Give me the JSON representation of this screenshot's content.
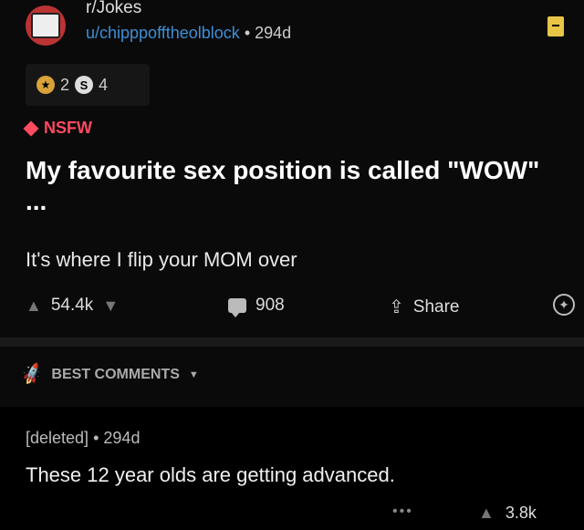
{
  "post": {
    "subreddit": "r/Jokes",
    "user": "u/chipppofftheolblock",
    "separator": "•",
    "age": "294d",
    "awards": [
      {
        "icon": "award-icon",
        "count": "2"
      },
      {
        "icon": "silver-award-icon",
        "glyph": "S",
        "count": "4"
      }
    ],
    "nsfw_label": "NSFW",
    "title": "My favourite sex position is called \"WOW\" ...",
    "body": "It's where I flip your MOM over",
    "upvotes": "54.4k",
    "comments": "908",
    "share_label": "Share"
  },
  "best_comments": {
    "label": "BEST COMMENTS"
  },
  "comment": {
    "author": "[deleted]",
    "separator": "•",
    "age": "294d",
    "text": "These 12 year olds are getting advanced.",
    "more": "•••",
    "upvotes": "3.8k"
  },
  "colors": {
    "accent_user": "#3d8fd6",
    "nsfw": "#ff4a60",
    "bookmark": "#e8c547"
  }
}
